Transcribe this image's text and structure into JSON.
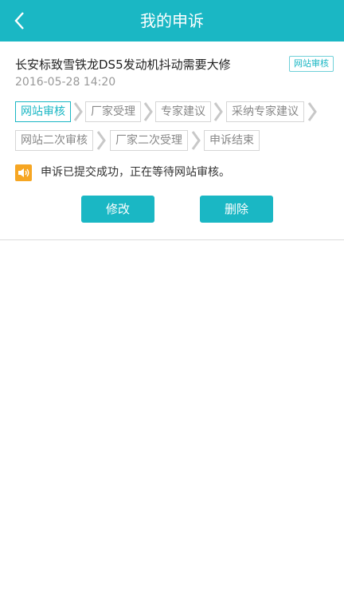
{
  "header": {
    "title": "我的申诉",
    "back_icon": "chevron-left-icon",
    "bg": "#1ab7c4"
  },
  "complaint": {
    "title": "长安标致雪铁龙DS5发动机抖动需要大修",
    "date": "2016-05-28 14:20",
    "status": "网站审核"
  },
  "steps": [
    {
      "label": "网站审核",
      "active": true
    },
    {
      "label": "厂家受理",
      "active": false
    },
    {
      "label": "专家建议",
      "active": false
    },
    {
      "label": "采纳专家建议",
      "active": false
    },
    {
      "label": "网站二次审核",
      "active": false
    },
    {
      "label": "厂家二次受理",
      "active": false
    },
    {
      "label": "申诉结束",
      "active": false
    }
  ],
  "notice": {
    "icon": "speaker-icon",
    "text": "申诉已提交成功，正在等待网站审核。"
  },
  "actions": {
    "edit_label": "修改",
    "delete_label": "删除"
  }
}
